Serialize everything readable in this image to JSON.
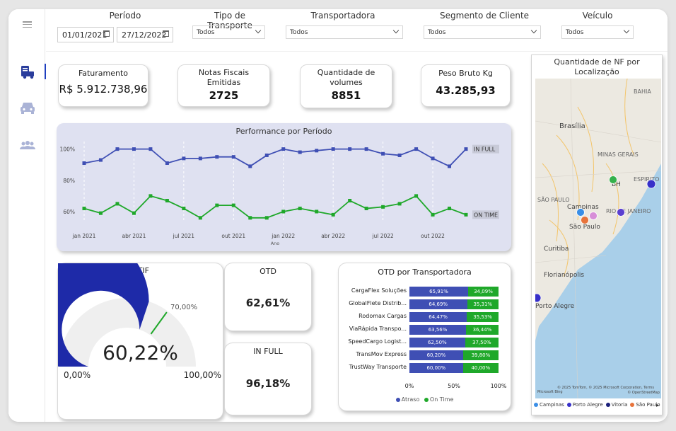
{
  "filters": {
    "periodo": {
      "label": "Período",
      "start": "01/01/2021",
      "end": "27/12/2022"
    },
    "tipo_transporte": {
      "label": "Tipo de Transporte",
      "value": "Todos"
    },
    "transportadora": {
      "label": "Transportadora",
      "value": "Todos"
    },
    "segmento": {
      "label": "Segmento de Cliente",
      "value": "Todos"
    },
    "veiculo": {
      "label": "Veículo",
      "value": "Todos"
    }
  },
  "sidebar": {
    "icons": [
      "menu-icon",
      "truck-report-icon",
      "vehicle-icon",
      "people-icon"
    ],
    "active_color": "#1f3fbf"
  },
  "kpis": {
    "faturamento": {
      "label": "Faturamento",
      "value": "R$ 5.912.738,96"
    },
    "notas": {
      "label": "Notas Fiscais Emitidas",
      "value": "2725"
    },
    "volumes": {
      "label": "Quantidade de volumes",
      "value": "8851"
    },
    "peso": {
      "label": "Peso Bruto Kg",
      "value": "43.285,93"
    }
  },
  "performance": {
    "title": "Performance por Período",
    "xlabel": "Ano"
  },
  "otif": {
    "title": "OTIF",
    "value": "60,22%",
    "min": "0,00%",
    "max": "100,00%",
    "target": "70,00%"
  },
  "otd": {
    "title": "OTD",
    "value": "62,61%"
  },
  "infull": {
    "title": "IN FULL",
    "value": "96,18%"
  },
  "otd_transp": {
    "title": "OTD por Transportadora",
    "legend": {
      "atraso": "Atraso",
      "ontime": "On Time"
    }
  },
  "map": {
    "title": "Quantidade de NF por Localização",
    "places": [
      "BAHIA",
      "Brasília",
      "MINAS GERAIS",
      "ESPIRITO",
      "BH",
      "SÃO PAULO",
      "Campinas",
      "São Paulo",
      "RIO DE JANEIRO",
      "Curitiba",
      "Florianópolis",
      "Porto Alegre"
    ],
    "attribution": "© 2025 TomTom, © 2025 Microsoft Corporation, Terms",
    "attribution2": "© OpenStreetMap",
    "bing": "Microsoft Bing",
    "legend": [
      {
        "name": "Campinas",
        "color": "#3a8ee6"
      },
      {
        "name": "Porto Alegre",
        "color": "#3730c9"
      },
      {
        "name": "Vitoria",
        "color": "#1a1f7a"
      },
      {
        "name": "São Paulo",
        "color": "#e8743b"
      }
    ]
  },
  "colors": {
    "blue": "#3f4fb4",
    "green": "#1fa82a",
    "navy": "#1e2aa8",
    "atraso": "#3f4fb4",
    "ontime": "#1fa82a"
  },
  "chart_data": [
    {
      "type": "line",
      "title": "Performance por Período",
      "xlabel": "Ano",
      "x_ticks": [
        "jan 2021",
        "abr 2021",
        "jul 2021",
        "out 2021",
        "jan 2022",
        "abr 2022",
        "jul 2022",
        "out 2022"
      ],
      "y_ticks": [
        "60%",
        "80%",
        "100%"
      ],
      "ylim": [
        55,
        103
      ],
      "x": [
        "jan 2021",
        "fev 2021",
        "mar 2021",
        "abr 2021",
        "mai 2021",
        "jun 2021",
        "jul 2021",
        "ago 2021",
        "set 2021",
        "out 2021",
        "nov 2021",
        "dez 2021",
        "jan 2022",
        "fev 2022",
        "mar 2022",
        "abr 2022",
        "mai 2022",
        "jun 2022",
        "jul 2022",
        "ago 2022",
        "set 2022",
        "out 2022",
        "nov 2022",
        "dez 2022"
      ],
      "series": [
        {
          "name": "IN FULL",
          "values": [
            91,
            93,
            100,
            100,
            100,
            91,
            94,
            94,
            95,
            95,
            89,
            96,
            100,
            98,
            99,
            100,
            100,
            100,
            97,
            96,
            100,
            94,
            89,
            100
          ]
        },
        {
          "name": "ON TIME",
          "values": [
            62,
            59,
            65,
            59,
            70,
            67,
            62,
            56,
            64,
            64,
            56,
            56,
            60,
            62,
            60,
            58,
            67,
            62,
            63,
            65,
            70,
            58,
            62,
            58
          ]
        }
      ]
    },
    {
      "type": "gauge",
      "title": "OTIF",
      "value": 60.22,
      "min": 0,
      "max": 100,
      "target": 70
    },
    {
      "type": "bar",
      "title": "OTD por Transportadora",
      "categories": [
        "CargaFlex Soluções",
        "GlobalFlete Distrib...",
        "Rodomax Cargas",
        "ViaRápida Transpo...",
        "SpeedCargo Logist...",
        "TransMov Express",
        "TrustWay Transporte"
      ],
      "x_ticks": [
        "0%",
        "50%",
        "100%"
      ],
      "series": [
        {
          "name": "Atraso",
          "values": [
            65.91,
            64.69,
            64.47,
            63.56,
            62.5,
            60.2,
            60.0
          ],
          "labels": [
            "65,91%",
            "64,69%",
            "64,47%",
            "63,56%",
            "62,50%",
            "60,20%",
            "60,00%"
          ]
        },
        {
          "name": "On Time",
          "values": [
            34.09,
            35.31,
            35.53,
            36.44,
            37.5,
            39.8,
            40.0
          ],
          "labels": [
            "34,09%",
            "35,31%",
            "35,53%",
            "36,44%",
            "37,50%",
            "39,80%",
            "40,00%"
          ]
        }
      ]
    }
  ]
}
